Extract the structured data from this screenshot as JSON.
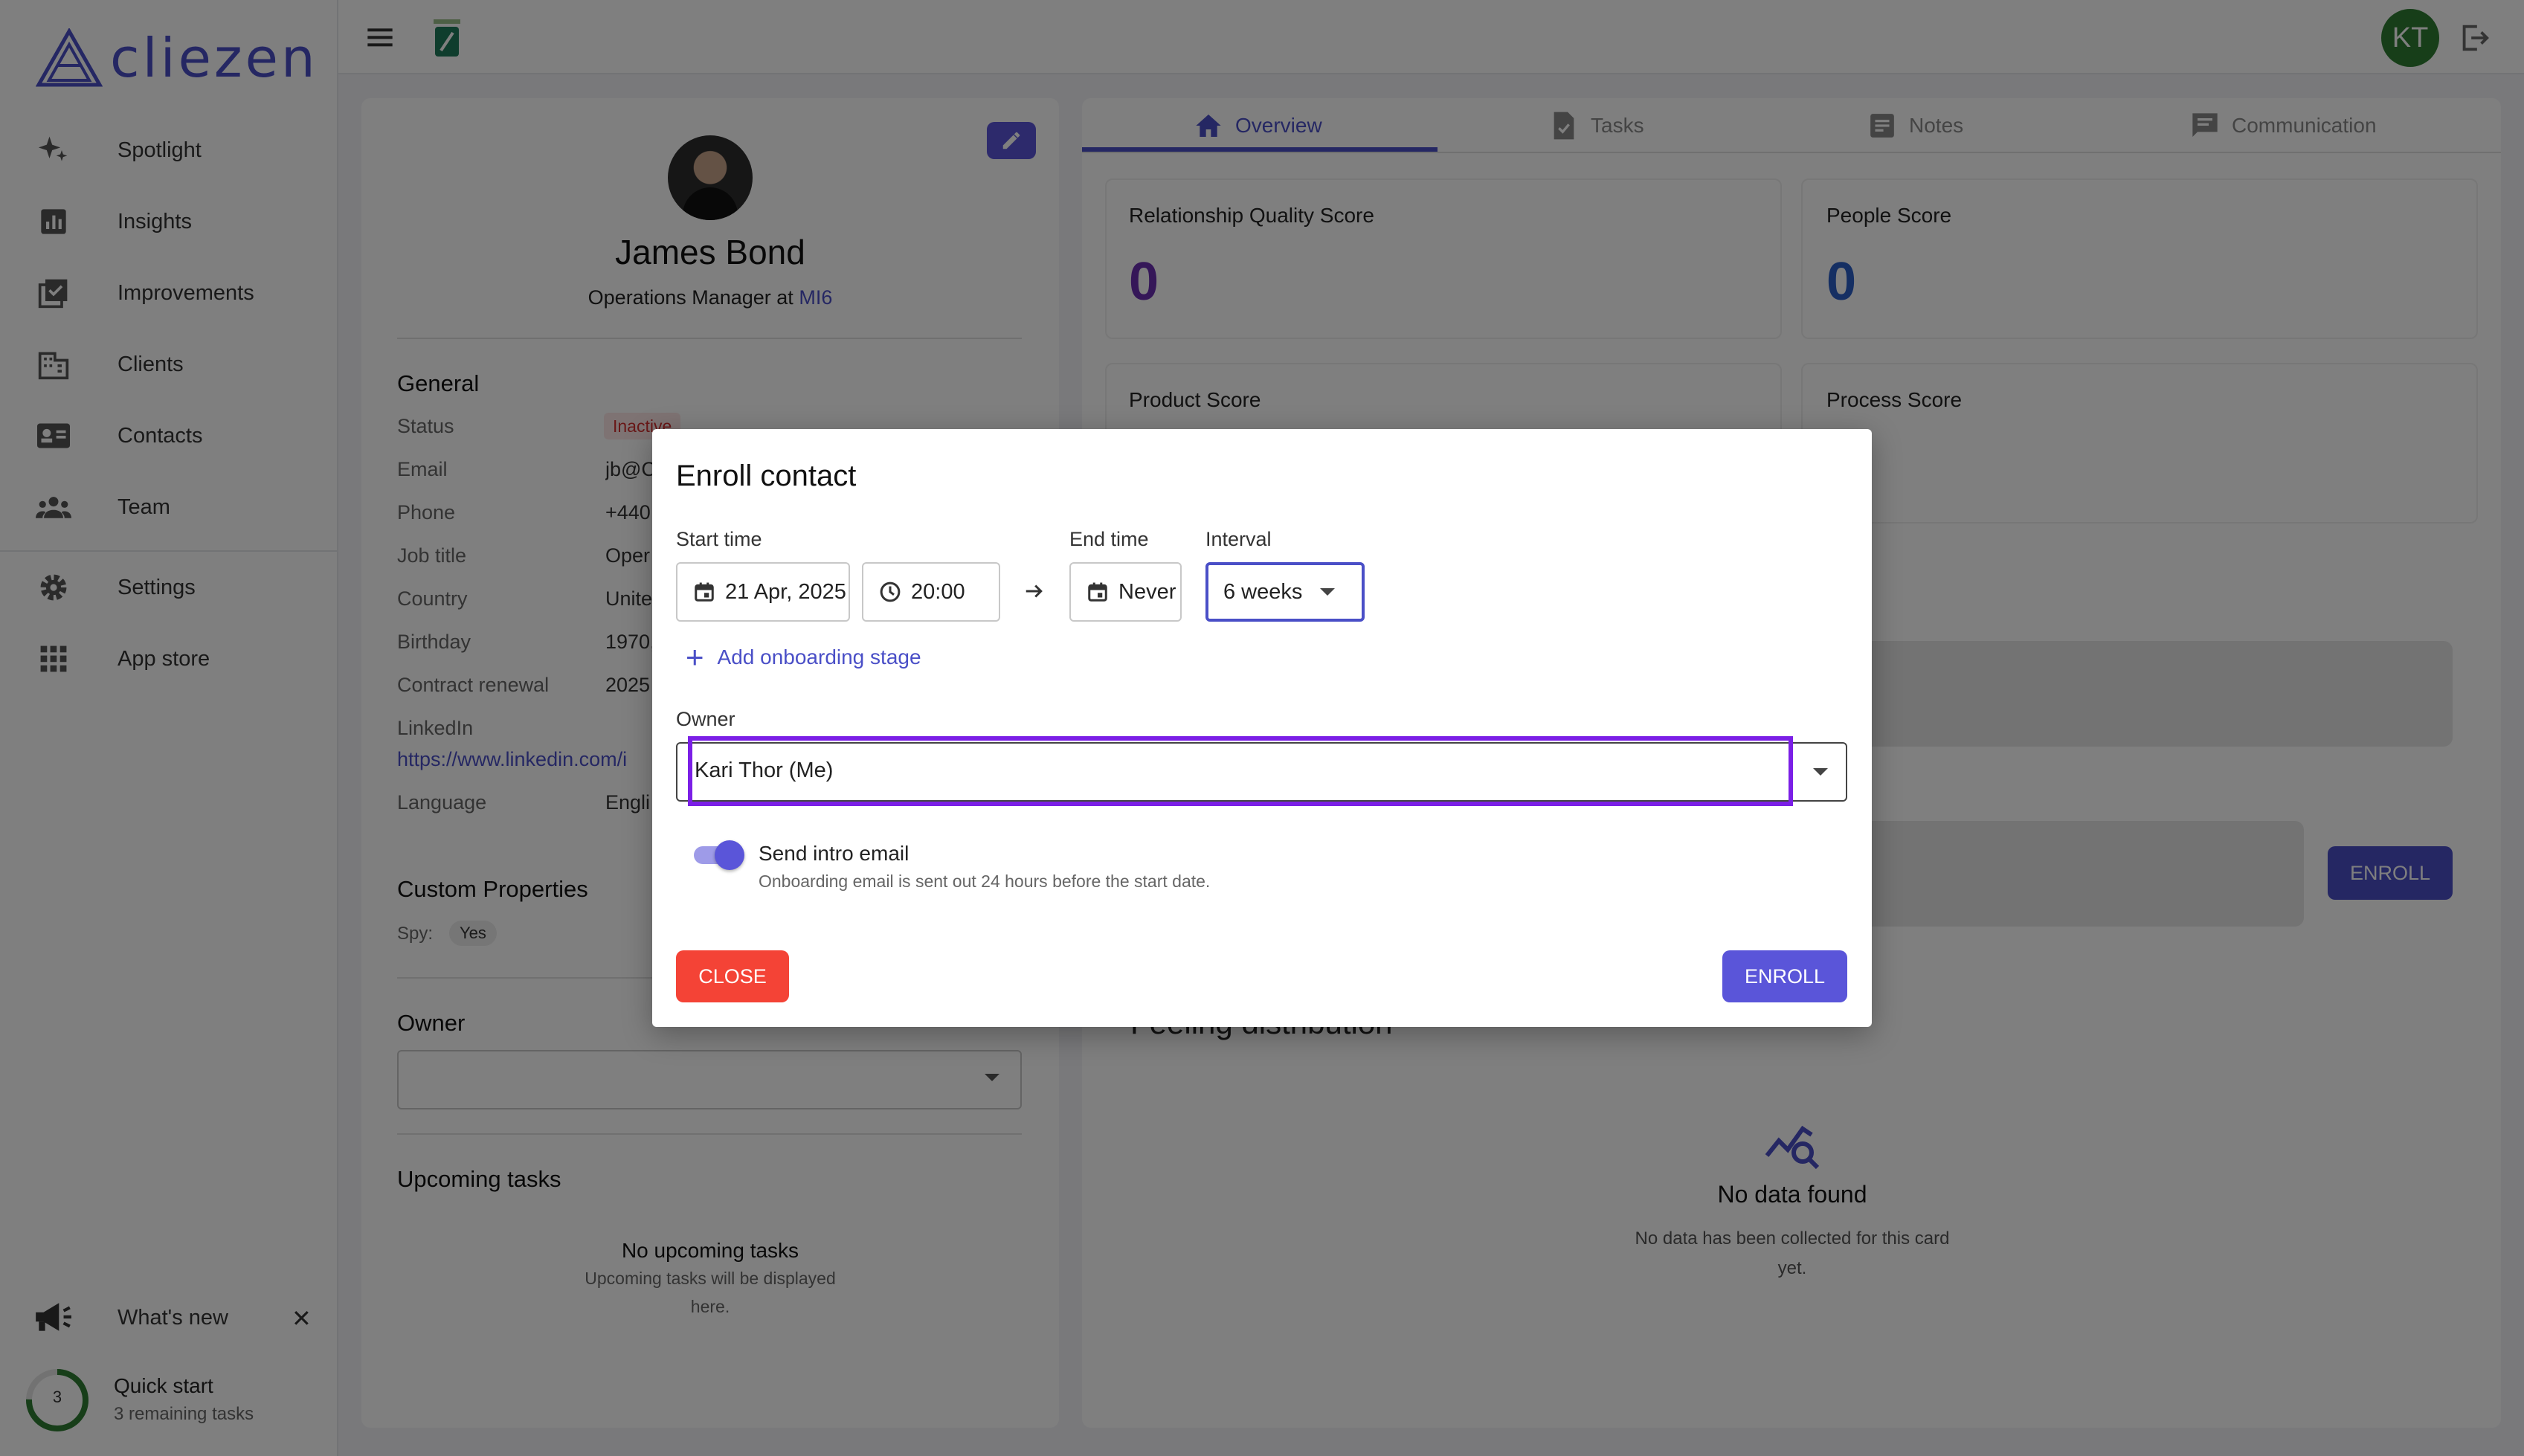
{
  "app": {
    "logo_text": "cliezen",
    "user_initials": "KT"
  },
  "sidebar": {
    "items": [
      {
        "label": "Spotlight",
        "icon": "sparkle-icon"
      },
      {
        "label": "Insights",
        "icon": "chart-icon"
      },
      {
        "label": "Improvements",
        "icon": "checklist-icon"
      },
      {
        "label": "Clients",
        "icon": "building-icon"
      },
      {
        "label": "Contacts",
        "icon": "contact-card-icon"
      },
      {
        "label": "Team",
        "icon": "group-icon"
      },
      {
        "label": "Settings",
        "icon": "gear-icon"
      },
      {
        "label": "App store",
        "icon": "grid-icon"
      }
    ],
    "whats_new": "What's new",
    "quick_start": {
      "title": "Quick start",
      "subtitle": "3 remaining tasks",
      "count": "3"
    }
  },
  "profile": {
    "name": "James Bond",
    "role_prefix": "Operations Manager at ",
    "company": "MI6",
    "general_title": "General",
    "fields": [
      {
        "label": "Status",
        "value": "Inactive"
      },
      {
        "label": "Email",
        "value": "jb@C"
      },
      {
        "label": "Phone",
        "value": "+440"
      },
      {
        "label": "Job title",
        "value": "Oper"
      },
      {
        "label": "Country",
        "value": "Unite"
      },
      {
        "label": "Birthday",
        "value": "1970,"
      },
      {
        "label": "Contract renewal",
        "value": "2025"
      },
      {
        "label": "LinkedIn",
        "value": "https://www.linkedin.com/i"
      },
      {
        "label": "Language",
        "value": "Engli"
      }
    ],
    "custom_properties_title": "Custom Properties",
    "spy_label": "Spy:",
    "spy_value": "Yes",
    "owner_title": "Owner",
    "upcoming_title": "Upcoming tasks",
    "no_upcoming": "No upcoming tasks",
    "no_upcoming_help_1": "Upcoming tasks will be displayed",
    "no_upcoming_help_2": "here."
  },
  "tabs": [
    {
      "label": "Overview",
      "icon": "home-icon",
      "active": true
    },
    {
      "label": "Tasks",
      "icon": "task-icon",
      "active": false
    },
    {
      "label": "Notes",
      "icon": "note-icon",
      "active": false
    },
    {
      "label": "Communication",
      "icon": "chat-icon",
      "active": false
    }
  ],
  "scores": {
    "relationship_title": "Relationship Quality Score",
    "relationship_value": "0",
    "people_title": "People Score",
    "people_value": "0",
    "product_title": "Product Score",
    "process_title": "Process Score"
  },
  "overview": {
    "enroll_label": "ENROLL",
    "feeling_title": "Feeling distribution",
    "no_data_title": "No data found",
    "no_data_text_1": "No data has been collected for this card",
    "no_data_text_2": "yet."
  },
  "modal": {
    "title": "Enroll contact",
    "start_time_label": "Start time",
    "start_date": "21 Apr, 2025",
    "start_time": "20:00",
    "end_time_label": "End time",
    "end_value": "Never",
    "interval_label": "Interval",
    "interval_value": "6 weeks",
    "add_stage": "Add onboarding stage",
    "owner_label": "Owner",
    "owner_value": "Kari Thor (Me)",
    "send_intro_label": "Send intro email",
    "send_intro_help": "Onboarding email is sent out 24 hours before the start date.",
    "send_intro_enabled": true,
    "close_label": "CLOSE",
    "enroll_label": "ENROLL"
  },
  "colors": {
    "accent": "#4a4fc7",
    "danger": "#f44336",
    "highlight": "#7b1fe6",
    "score_relationship": "#6a2fb0",
    "score_people": "#2b5fc7"
  }
}
